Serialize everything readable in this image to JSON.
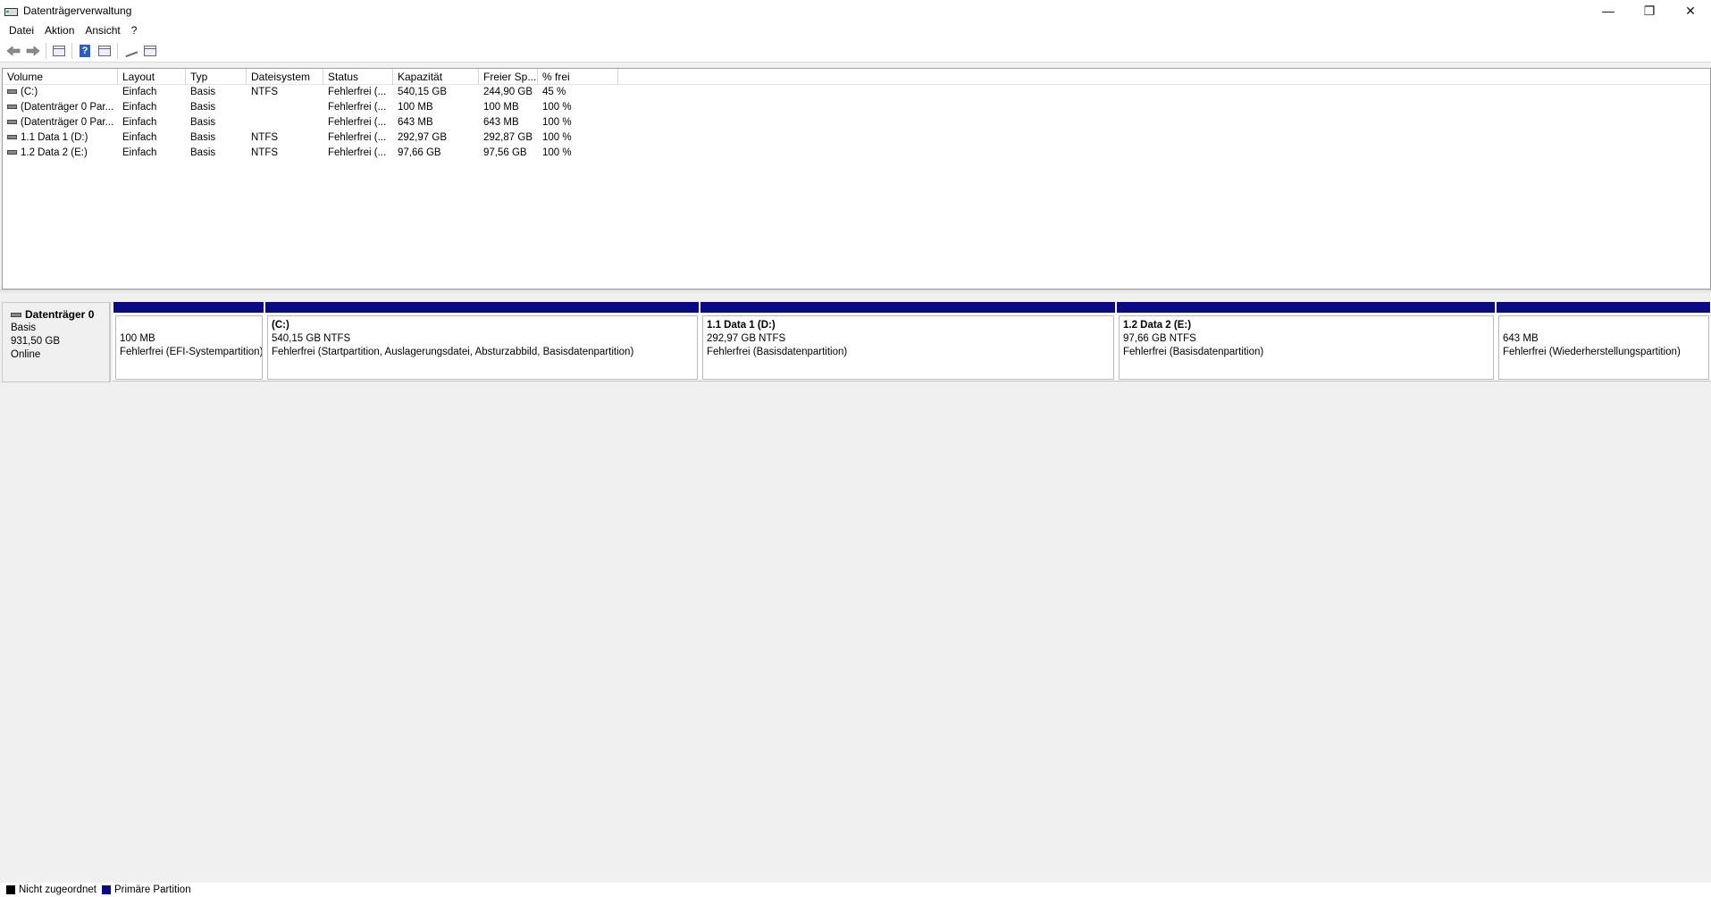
{
  "window": {
    "title": "Datenträgerverwaltung",
    "minimize": "—",
    "restore": "❐",
    "close": "✕"
  },
  "menu": [
    "Datei",
    "Aktion",
    "Ansicht",
    "?"
  ],
  "toolbar": {
    "icons": [
      "back-icon",
      "forward-icon",
      "console-tree-icon",
      "help-icon",
      "properties-icon",
      "rescan-icon",
      "view-icon"
    ]
  },
  "volume_list": {
    "columns": [
      "Volume",
      "Layout",
      "Typ",
      "Dateisystem",
      "Status",
      "Kapazität",
      "Freier Sp...",
      "% frei"
    ],
    "rows": [
      [
        "(C:)",
        "Einfach",
        "Basis",
        "NTFS",
        "Fehlerfrei (...",
        "540,15 GB",
        "244,90 GB",
        "45 %"
      ],
      [
        "(Datenträger 0 Par...",
        "Einfach",
        "Basis",
        "",
        "Fehlerfrei (...",
        "100 MB",
        "100 MB",
        "100 %"
      ],
      [
        "(Datenträger 0 Par...",
        "Einfach",
        "Basis",
        "",
        "Fehlerfrei (...",
        "643 MB",
        "643 MB",
        "100 %"
      ],
      [
        "1.1 Data 1 (D:)",
        "Einfach",
        "Basis",
        "NTFS",
        "Fehlerfrei (...",
        "292,97 GB",
        "292,87 GB",
        "100 %"
      ],
      [
        "1.2 Data 2 (E:)",
        "Einfach",
        "Basis",
        "NTFS",
        "Fehlerfrei (...",
        "97,66 GB",
        "97,56 GB",
        "100 %"
      ]
    ]
  },
  "disk": {
    "name": "Datenträger 0",
    "type": "Basis",
    "size": "931,50 GB",
    "state": "Online",
    "partitions": [
      {
        "name": "",
        "size": "100 MB",
        "status": "Fehlerfrei (EFI-Systempartition)"
      },
      {
        "name": "(C:)",
        "size": "540,15 GB NTFS",
        "status": "Fehlerfrei (Startpartition, Auslagerungsdatei, Absturzabbild, Basisdatenpartition)"
      },
      {
        "name": "1.1 Data 1  (D:)",
        "size": "292,97 GB NTFS",
        "status": "Fehlerfrei (Basisdatenpartition)"
      },
      {
        "name": "1.2 Data 2  (E:)",
        "size": "97,66 GB NTFS",
        "status": "Fehlerfrei (Basisdatenpartition)"
      },
      {
        "name": "",
        "size": "643 MB",
        "status": "Fehlerfrei (Wiederherstellungspartition)"
      }
    ]
  },
  "legend": [
    {
      "label": "Nicht zugeordnet",
      "color": "#000000"
    },
    {
      "label": "Primäre Partition",
      "color": "#0a0a82"
    }
  ]
}
